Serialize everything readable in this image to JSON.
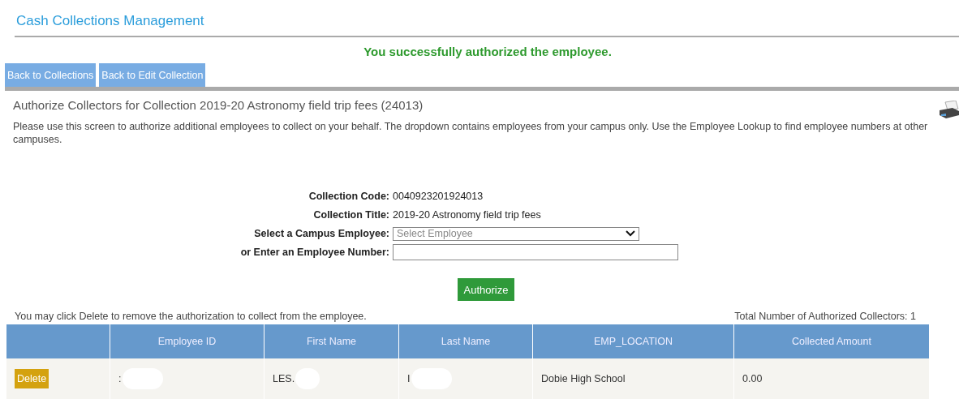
{
  "page_title": "Cash Collections Management",
  "message": "You successfully authorized the employee.",
  "nav_buttons": [
    "Back to Collections",
    "Back to Edit Collection"
  ],
  "heading": "Authorize Collectors for Collection 2019-20 Astronomy field trip fees (24013)",
  "instructions": "Please use this screen to authorize additional employees to collect on your behalf. The dropdown contains employees from your campus only. Use the Employee Lookup to find employee numbers at other campuses.",
  "form": [
    {
      "kind": "text",
      "label": "Collection Code:",
      "value": "0040923201924013"
    },
    {
      "kind": "text",
      "label": "Collection Title:",
      "value": "2019-20 Astronomy field trip fees"
    },
    {
      "kind": "select",
      "label": "Select a Campus Employee:",
      "placeholder": "Select Employee"
    },
    {
      "kind": "input",
      "label": "or Enter an Employee Number:"
    }
  ],
  "authorize_button": "Authorize",
  "delete_note": "You may click Delete to remove the authorization to collect from the employee.",
  "total": "Total Number of Authorized Collectors: 1",
  "table": {
    "columns": [
      "",
      "Employee ID",
      "First Name",
      "Last Name",
      "EMP_LOCATION",
      "Collected Amount"
    ],
    "rows": [
      {
        "action": "Delete",
        "employee_id": ":",
        "first_name": "LES.",
        "last_name": "I",
        "location": "Dobie High School",
        "amount": "0.00"
      }
    ]
  }
}
